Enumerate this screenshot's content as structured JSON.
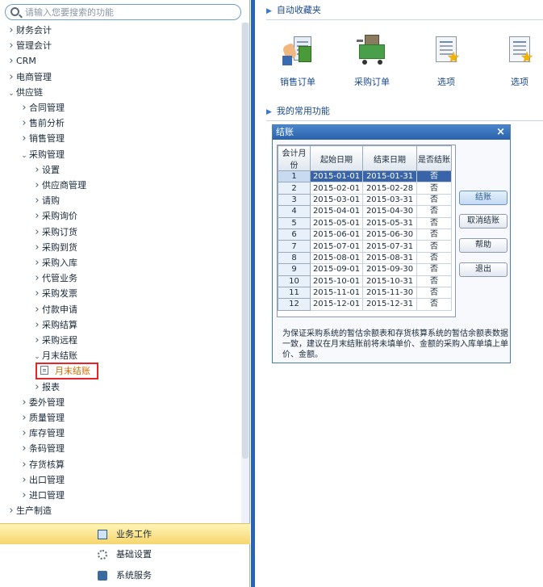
{
  "search": {
    "placeholder": "请输入您要搜索的功能"
  },
  "tree": [
    {
      "label": "财务会计",
      "level": 0,
      "expanded": false
    },
    {
      "label": "管理会计",
      "level": 0,
      "expanded": false
    },
    {
      "label": "CRM",
      "level": 0,
      "expanded": false
    },
    {
      "label": "电商管理",
      "level": 0,
      "expanded": false
    },
    {
      "label": "供应链",
      "level": 0,
      "expanded": true
    },
    {
      "label": "合同管理",
      "level": 1,
      "expanded": false
    },
    {
      "label": "售前分析",
      "level": 1,
      "expanded": false
    },
    {
      "label": "销售管理",
      "level": 1,
      "expanded": false
    },
    {
      "label": "采购管理",
      "level": 1,
      "expanded": true
    },
    {
      "label": "设置",
      "level": 2,
      "expanded": false
    },
    {
      "label": "供应商管理",
      "level": 2,
      "expanded": false
    },
    {
      "label": "请购",
      "level": 2,
      "expanded": false
    },
    {
      "label": "采购询价",
      "level": 2,
      "expanded": false
    },
    {
      "label": "采购订货",
      "level": 2,
      "expanded": false
    },
    {
      "label": "采购到货",
      "level": 2,
      "expanded": false
    },
    {
      "label": "采购入库",
      "level": 2,
      "expanded": false
    },
    {
      "label": "代管业务",
      "level": 2,
      "expanded": false
    },
    {
      "label": "采购发票",
      "level": 2,
      "expanded": false
    },
    {
      "label": "付款申请",
      "level": 2,
      "expanded": false
    },
    {
      "label": "采购结算",
      "level": 2,
      "expanded": false
    },
    {
      "label": "采购远程",
      "level": 2,
      "expanded": false
    },
    {
      "label": "月末结账",
      "level": 2,
      "expanded": true
    },
    {
      "label": "报表",
      "level": 2,
      "expanded": false
    },
    {
      "label": "委外管理",
      "level": 1,
      "expanded": false
    },
    {
      "label": "质量管理",
      "level": 1,
      "expanded": false
    },
    {
      "label": "库存管理",
      "level": 1,
      "expanded": false
    },
    {
      "label": "条码管理",
      "level": 1,
      "expanded": false
    },
    {
      "label": "存货核算",
      "level": 1,
      "expanded": false
    },
    {
      "label": "出口管理",
      "level": 1,
      "expanded": false
    },
    {
      "label": "进口管理",
      "level": 1,
      "expanded": false
    },
    {
      "label": "生产制造",
      "level": 0,
      "expanded": false
    }
  ],
  "selected_leaf": {
    "label": "月末结账"
  },
  "nav": [
    {
      "label": "业务工作",
      "icon": "business-icon",
      "active": true
    },
    {
      "label": "基础设置",
      "icon": "gear-icon",
      "active": false
    },
    {
      "label": "系统服务",
      "icon": "system-service-icon",
      "active": false
    }
  ],
  "favorites": {
    "title": "自动收藏夹",
    "items": [
      {
        "label": "销售订单",
        "icon": "sales-order-icon"
      },
      {
        "label": "采购订单",
        "icon": "purchase-order-icon"
      },
      {
        "label": "选项",
        "icon": "options-icon"
      },
      {
        "label": "选项",
        "icon": "options-icon"
      }
    ]
  },
  "common": {
    "title": "我的常用功能"
  },
  "dialog": {
    "title": "结账",
    "columns": [
      "会计月份",
      "起始日期",
      "结束日期",
      "是否结账"
    ],
    "rows": [
      [
        "1",
        "2015-01-01",
        "2015-01-31",
        "否"
      ],
      [
        "2",
        "2015-02-01",
        "2015-02-28",
        "否"
      ],
      [
        "3",
        "2015-03-01",
        "2015-03-31",
        "否"
      ],
      [
        "4",
        "2015-04-01",
        "2015-04-30",
        "否"
      ],
      [
        "5",
        "2015-05-01",
        "2015-05-31",
        "否"
      ],
      [
        "6",
        "2015-06-01",
        "2015-06-30",
        "否"
      ],
      [
        "7",
        "2015-07-01",
        "2015-07-31",
        "否"
      ],
      [
        "8",
        "2015-08-01",
        "2015-08-31",
        "否"
      ],
      [
        "9",
        "2015-09-01",
        "2015-09-30",
        "否"
      ],
      [
        "10",
        "2015-10-01",
        "2015-10-31",
        "否"
      ],
      [
        "11",
        "2015-11-01",
        "2015-11-30",
        "否"
      ],
      [
        "12",
        "2015-12-01",
        "2015-12-31",
        "否"
      ]
    ],
    "selected_row": 0,
    "buttons": [
      "结账",
      "取消结账",
      "帮助",
      "退出"
    ],
    "note": "为保证采购系统的暂估余额表和存货核算系统的暂估余额表数据一致，建议在月末结账前将未填单价、金额的采购入库单填上单价、金额。"
  },
  "colors": {
    "accent": "#2a64b4",
    "selection": "#3a64a8",
    "highlight_border": "#e8232a",
    "active_nav": "#f6d66c"
  }
}
